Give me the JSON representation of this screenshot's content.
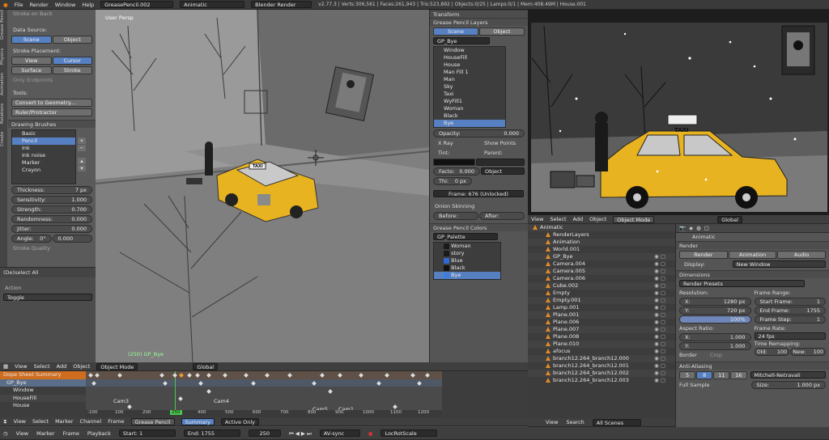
{
  "topbar": {
    "menus": [
      "File",
      "Render",
      "Window",
      "Help"
    ],
    "screen": "GreasePencil.002",
    "scene": "Animatic",
    "engine": "Blender Render",
    "stats": "v2.77.3 | Verts:306,561 | Faces:261,943 | Tris:523,892 | Objects:0/25 | Lamps:0/1 | Mem:408.49M | House.001"
  },
  "left_panel": {
    "stroke_label": "Stroke on Back",
    "data_source_label": "Data Source:",
    "data_source": [
      "Scene",
      "Object"
    ],
    "stroke_placement_label": "Stroke Placement:",
    "placement_row1": [
      "View",
      "Cursor"
    ],
    "placement_row2": [
      "Surface",
      "Stroke"
    ],
    "only_endpoints": "Only Endpoints",
    "tools_label": "Tools:",
    "convert": "Convert to Geometry...",
    "ruler": "Ruler/Protractor",
    "drawing_brushes": "Drawing Brushes",
    "brushes": [
      "Basic",
      "Pencil",
      "Ink",
      "Ink noise",
      "Marker",
      "Crayon"
    ],
    "thickness_label": "Thickness:",
    "thickness_value": "7 px",
    "sensitivity_label": "Sensitivity:",
    "sensitivity_value": "1.000",
    "strength_label": "Strength:",
    "strength_value": "0.700",
    "randomness_label": "Randomness:",
    "randomness_value": "0.000",
    "jitter_label": "Jitter:",
    "jitter_value": "0.000",
    "angle_label": "Angle:",
    "angle_value": "0°",
    "angle_value2": "0.000",
    "stroke_quality": "Stroke Quality",
    "deselect_all": "(De)select All",
    "action_label": "Action",
    "action_value": "Toggle",
    "tabs": [
      "Create",
      "Relations",
      "Animation",
      "Physics",
      "Grease Pencil"
    ]
  },
  "viewport": {
    "label": "User Persp",
    "footer_label": "(250) GP_Bye",
    "taxi_sign": "TAXI"
  },
  "gp_panel": {
    "transform": "Transform",
    "layers_title": "Grease Pencil Layers",
    "source_tabs": [
      "Scene",
      "Object"
    ],
    "gp_name": "GP_Bye",
    "layers": [
      "Window",
      "HouseFill",
      "House",
      "Man Fill 1",
      "Man",
      "Sky",
      "Taxi",
      "WyFill1",
      "Woman",
      "Black",
      "Bye"
    ],
    "opacity_label": "Opacity:",
    "opacity_value": "0.000",
    "xray": "X Ray",
    "show_points": "Show Points",
    "tint_label": "Tint:",
    "parent_label": "Parent:",
    "factor_label": "Facto:",
    "factor_value": "0.000",
    "thickness_label": "Thi:",
    "thickness_value": "0 px",
    "parent_value": "Object",
    "frame_label": "Frame: 676 (Unlocked)",
    "onion": "Onion Skinning",
    "before": "Before:",
    "after": "After:",
    "colors_title": "Grease Pencil Colors",
    "palette": "GP_Palette",
    "colors": [
      {
        "name": "Woman",
        "color": "#1a1a1a"
      },
      {
        "name": "story",
        "color": "#1a1a1a"
      },
      {
        "name": "Blue",
        "color": "#2d6ad8"
      },
      {
        "name": "Black",
        "color": "#111111"
      },
      {
        "name": "Bye",
        "color": "#3d7fd8"
      }
    ]
  },
  "render_view": {
    "taxi_sign": "TAXI"
  },
  "outliner": {
    "header": [
      "View",
      "Select",
      "Add",
      "Object",
      "Object Mode",
      "Global"
    ],
    "items": [
      "Animatic",
      "RenderLayers",
      "Animation",
      "World.001",
      "GP_Bye",
      "Camera.004",
      "Camera.005",
      "Camera.006",
      "Cube.002",
      "Empty",
      "Empty.001",
      "Lamp.001",
      "Plane.001",
      "Plane.006",
      "Plane.007",
      "Plane.008",
      "Plane.010",
      "afocus",
      "branch12.264_branch12.000",
      "branch12.264_branch12.001",
      "branch12.264_branch12.002",
      "branch12.264_branch12.003"
    ],
    "footer": [
      "View",
      "Search",
      "All Scenes"
    ]
  },
  "properties": {
    "scene": "Animatic",
    "render_title": "Render",
    "render_buttons": [
      "Render",
      "Animation",
      "Audio"
    ],
    "display_label": "Display:",
    "display_value": "New Window",
    "dimensions_title": "Dimensions",
    "render_presets": "Render Presets",
    "resolution_label": "Resolution:",
    "res_x": "1280 px",
    "res_y": "720 px",
    "res_pct": "100%",
    "frame_range_label": "Frame Range:",
    "start_frame": "1",
    "end_frame": "1755",
    "frame_step": "1",
    "aspect_label": "Aspect Ratio:",
    "aspect_x": "1.000",
    "aspect_y": "1.000",
    "frame_rate_label": "Frame Rate:",
    "fps": "24 fps",
    "time_remap_label": "Time Remapping:",
    "old": "100",
    "new": "100",
    "border": "Border",
    "crop": "Crop",
    "aa_title": "Anti-Aliasing",
    "aa_samples": [
      "5",
      "8",
      "11",
      "16"
    ],
    "filter": "Mitchell-Netravali",
    "full_sample": "Full Sample",
    "size_label": "Size:",
    "size_value": "1.000 px",
    "labels": {
      "x": "X:",
      "y": "Y:",
      "start": "Start Frame:",
      "end": "End Frame:",
      "step": "Frame Step:",
      "old": "Old:",
      "new": "New:"
    }
  },
  "dopesheet": {
    "rows": [
      "Dope Sheet Summary",
      "GP_Bye",
      "Window",
      "HouseFill",
      "House"
    ],
    "markers": [
      "Cam3",
      "Cam4",
      "Cam5",
      "Cam1"
    ],
    "current_frame": "250",
    "ruler": [
      "-100",
      "100",
      "200",
      "300",
      "400",
      "500",
      "600",
      "700",
      "800",
      "900",
      "1000",
      "1100",
      "1200"
    ],
    "header": [
      "View",
      "Select",
      "Marker",
      "Channel",
      "Frame",
      "Grease Pencil",
      "Summary",
      "Active Only"
    ],
    "header_top": [
      "View",
      "Select",
      "Add",
      "Object",
      "Object Mode",
      "Global"
    ]
  },
  "timeline": {
    "menus": [
      "View",
      "Marker",
      "Frame",
      "Playback"
    ],
    "start_label": "Start:",
    "start_value": "1",
    "end_label": "End:",
    "end_value": "1755",
    "current": "250",
    "sync": "AV-sync",
    "keying": "LocRotScale"
  }
}
